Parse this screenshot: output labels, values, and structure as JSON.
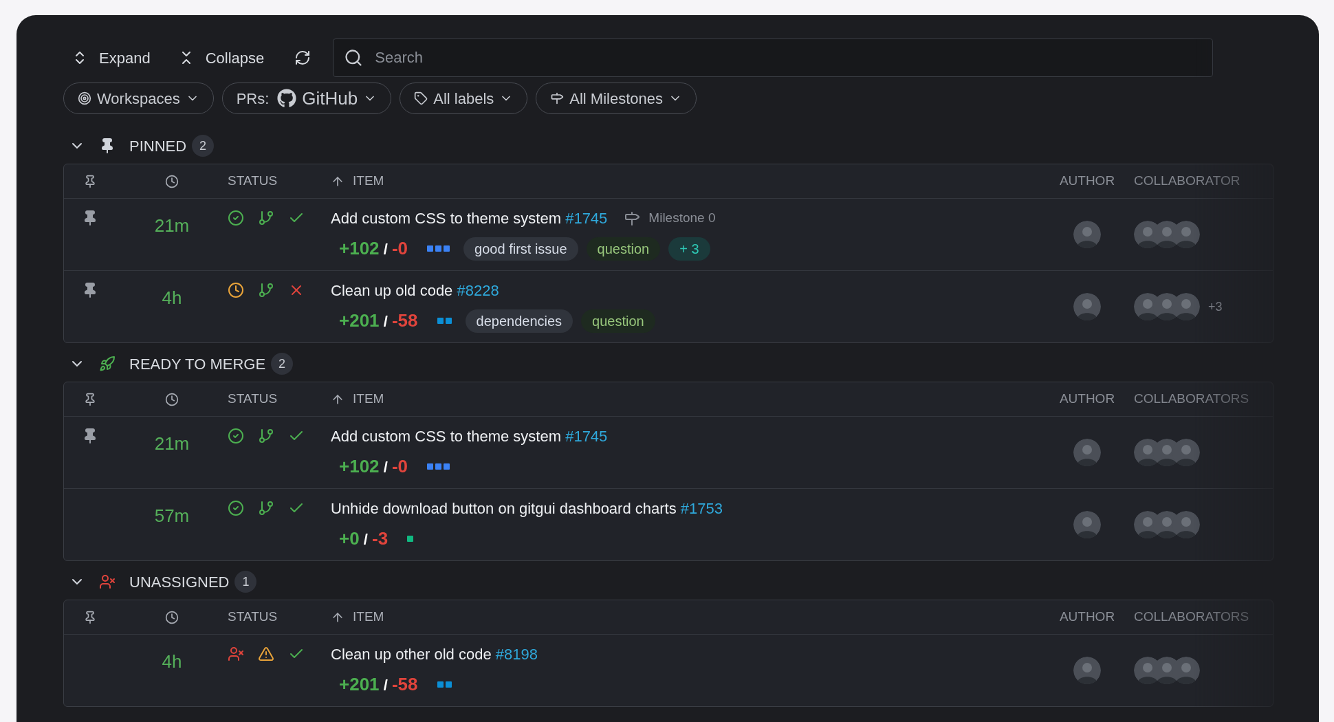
{
  "toolbar": {
    "expand": "Expand",
    "collapse": "Collapse",
    "search": {
      "placeholder": "Search"
    }
  },
  "filters": [
    {
      "kind": "workspaces",
      "label": "Workspaces"
    },
    {
      "kind": "prs",
      "label": "PRs:",
      "value": "GitHub"
    },
    {
      "kind": "labels",
      "label": "All labels"
    },
    {
      "kind": "milestones",
      "label": "All Milestones"
    }
  ],
  "sections": [
    {
      "kind": "pinned",
      "title": "PINNED",
      "count": "2",
      "expanded": true,
      "columns": {
        "status": "STATUS",
        "item": "ITEM",
        "author": "AUTHOR",
        "collaborators": "COLLABORATOR"
      },
      "rows": [
        {
          "pinned": true,
          "age": "21m",
          "status": [
            {
              "kind": "check-circle"
            },
            {
              "kind": "branch"
            },
            {
              "kind": "check"
            }
          ],
          "title": "Add custom CSS to theme system",
          "number": "#1745",
          "milestone": "Milestone 0",
          "additions": "+102",
          "separator": "/",
          "deletions": "-0",
          "blocks": [
            {
              "color": "#3b82f6"
            },
            {
              "color": "#3b82f6"
            },
            {
              "color": "#3b82f6"
            }
          ],
          "labels": [
            {
              "kind": "neutral",
              "text": "good first issue"
            },
            {
              "kind": "green",
              "text": "question"
            },
            {
              "kind": "more",
              "text": "+ 3"
            }
          ],
          "collaborators": [
            {
              "kind": "picture"
            },
            {
              "kind": "picture"
            },
            {
              "kind": "picture"
            }
          ]
        },
        {
          "pinned": true,
          "age": "4h",
          "status": [
            {
              "kind": "clock"
            },
            {
              "kind": "branch"
            },
            {
              "kind": "x"
            }
          ],
          "title": "Clean up old code",
          "number": "#8228",
          "additions": "+201",
          "separator": "/",
          "deletions": "-58",
          "blocks": [
            {
              "color": "#0b8fd6"
            },
            {
              "color": "#0b8fd6"
            }
          ],
          "labels": [
            {
              "kind": "neutral",
              "text": "dependencies"
            },
            {
              "kind": "green",
              "text": "question"
            }
          ],
          "collaborators": [
            {
              "kind": "picture"
            },
            {
              "kind": "picture"
            },
            {
              "kind": "picture"
            }
          ],
          "more_collaborators": "+3"
        }
      ]
    },
    {
      "kind": "ready",
      "title": "READY TO MERGE",
      "count": "2",
      "expanded": true,
      "columns": {
        "status": "STATUS",
        "item": "ITEM",
        "author": "AUTHOR",
        "collaborators": "COLLABORATORS"
      },
      "rows": [
        {
          "pinned": true,
          "age": "21m",
          "status": [
            {
              "kind": "check-circle"
            },
            {
              "kind": "branch"
            },
            {
              "kind": "check"
            }
          ],
          "title": "Add custom CSS to theme system",
          "number": "#1745",
          "additions": "+102",
          "separator": "/",
          "deletions": "-0",
          "blocks": [
            {
              "color": "#3b82f6"
            },
            {
              "color": "#3b82f6"
            },
            {
              "color": "#3b82f6"
            }
          ],
          "labels": [],
          "collaborators": [
            {
              "kind": "picture"
            },
            {
              "kind": "picture"
            },
            {
              "kind": "picture"
            }
          ]
        },
        {
          "pinned": false,
          "age": "57m",
          "status": [
            {
              "kind": "check-circle"
            },
            {
              "kind": "branch"
            },
            {
              "kind": "check"
            }
          ],
          "title": "Unhide download button on gitgui dashboard charts",
          "number": "#1753",
          "additions": "+0",
          "separator": "/",
          "deletions": "-3",
          "blocks": [
            {
              "color": "#10b981"
            }
          ],
          "labels": [],
          "collaborators": [
            {
              "kind": "picture"
            },
            {
              "kind": "picture"
            },
            {
              "kind": "picture"
            }
          ]
        }
      ]
    },
    {
      "kind": "unassigned",
      "title": "UNASSIGNED",
      "count": "1",
      "expanded": true,
      "columns": {
        "status": "STATUS",
        "item": "ITEM",
        "author": "AUTHOR",
        "collaborators": "COLLABORATORS"
      },
      "rows": [
        {
          "pinned": false,
          "age": "4h",
          "status": [
            {
              "kind": "unassigned"
            },
            {
              "kind": "warning"
            },
            {
              "kind": "check"
            }
          ],
          "title": "Clean up other old code",
          "number": "#8198",
          "additions": "+201",
          "separator": "/",
          "deletions": "-58",
          "blocks": [
            {
              "color": "#0b8fd6"
            },
            {
              "color": "#0b8fd6"
            }
          ],
          "labels": [],
          "collaborators": [
            {
              "kind": "picture"
            },
            {
              "kind": "picture"
            },
            {
              "kind": "picture"
            }
          ]
        }
      ]
    }
  ]
}
